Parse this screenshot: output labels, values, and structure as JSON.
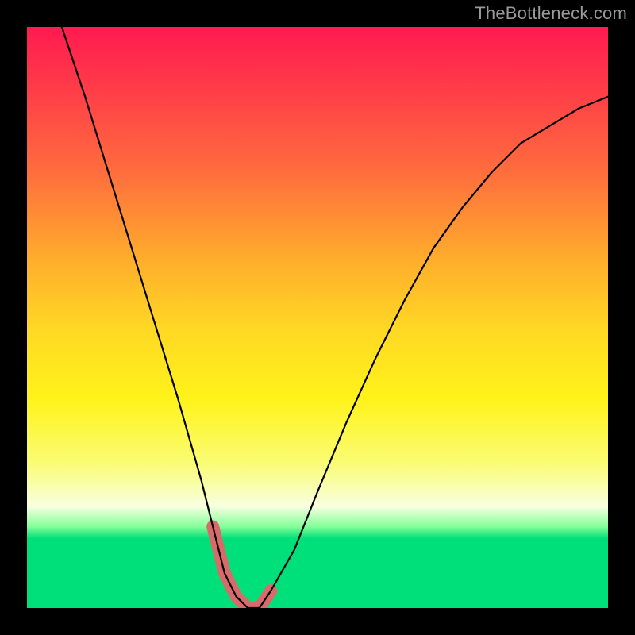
{
  "watermark": "TheBottleneck.com",
  "colors": {
    "curve": "#000000",
    "accent": "#d96a6a",
    "frame": "#000000"
  },
  "chart_data": {
    "type": "line",
    "title": "",
    "xlabel": "",
    "ylabel": "",
    "xlim": [
      0,
      100
    ],
    "ylim": [
      0,
      100
    ],
    "grid": false,
    "legend": false,
    "background_gradient": [
      "#ff1a50",
      "#ffad2c",
      "#fff31a",
      "#00e07a"
    ],
    "series": [
      {
        "name": "bottleneck-curve",
        "x": [
          6,
          10,
          14,
          18,
          22,
          26,
          30,
          32,
          34,
          36,
          38,
          40,
          42,
          46,
          50,
          55,
          60,
          65,
          70,
          75,
          80,
          85,
          90,
          95,
          100
        ],
        "values": [
          100,
          88,
          75,
          62,
          49,
          36,
          22,
          14,
          6,
          2,
          0,
          0,
          3,
          10,
          20,
          32,
          43,
          53,
          62,
          69,
          75,
          80,
          83,
          86,
          88
        ]
      }
    ],
    "accent_segment": {
      "name": "bottom-highlight",
      "x": [
        32,
        34,
        36,
        38,
        40,
        42
      ],
      "values": [
        14,
        6,
        2,
        0,
        0,
        3
      ]
    }
  }
}
